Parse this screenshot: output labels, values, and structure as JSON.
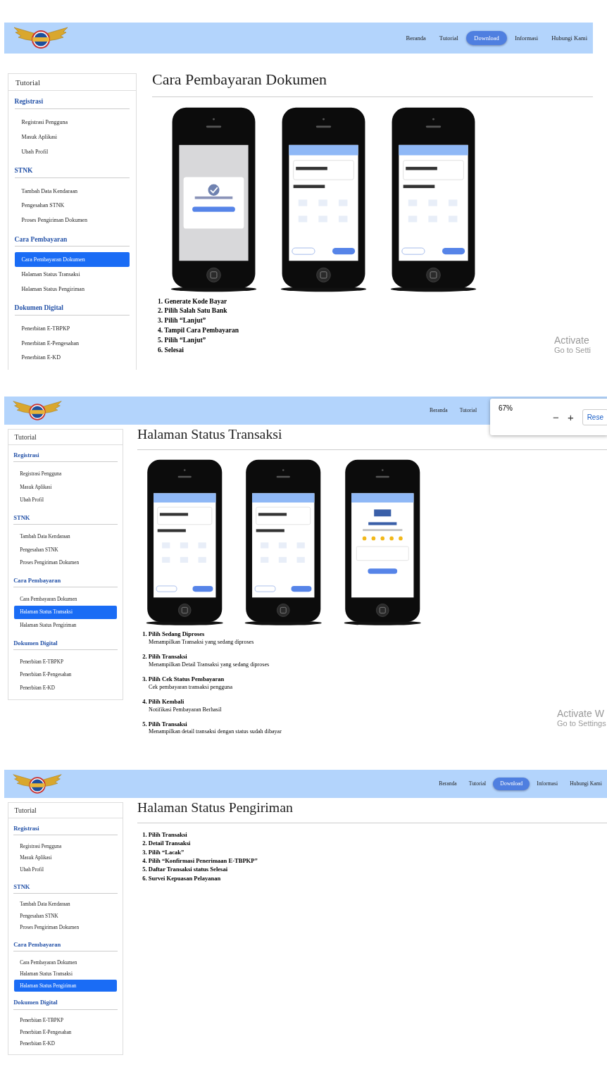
{
  "screens": [
    {
      "nav": [
        {
          "label": "Beranda",
          "selected": false
        },
        {
          "label": "Tutorial",
          "selected": false
        },
        {
          "label": "Download",
          "selected": true
        },
        {
          "label": "Informasi",
          "selected": false
        },
        {
          "label": "Hubungi Kami",
          "selected": false
        }
      ],
      "sidebar": {
        "title": "Tutorial",
        "sections": [
          {
            "heading": "Registrasi",
            "items": [
              {
                "label": "Registrasi Pengguna",
                "selected": false
              },
              {
                "label": "Masuk Aplikasi",
                "selected": false
              },
              {
                "label": "Ubah Profil",
                "selected": false
              }
            ]
          },
          {
            "heading": "STNK",
            "items": [
              {
                "label": "Tambah Data Kendaraan",
                "selected": false
              },
              {
                "label": "Pengesahan STNK",
                "selected": false
              },
              {
                "label": "Proses Pengiriman Dokumen",
                "selected": false
              }
            ]
          },
          {
            "heading": "Cara Pembayaran",
            "items": [
              {
                "label": "Cara Pembayaran Dokumen",
                "selected": true
              },
              {
                "label": "Halaman Status Transaksi",
                "selected": false
              },
              {
                "label": "Halaman Status Pengiriman",
                "selected": false
              }
            ]
          },
          {
            "heading": "Dokumen Digital",
            "items": [
              {
                "label": "Penerbitan E-TBPKP",
                "selected": false
              },
              {
                "label": "Penerbitan E-Pengesahan",
                "selected": false
              },
              {
                "label": "Penerbitan E-KD",
                "selected": false
              }
            ]
          }
        ]
      },
      "page_title": "Cara Pembayaran Dokumen",
      "phones": [
        {
          "kind": "dialog"
        },
        {
          "kind": "payment"
        },
        {
          "kind": "payment"
        }
      ],
      "steps": [
        {
          "title": "1. Generate Kode Bayar"
        },
        {
          "title": "2. Pilih Salah Satu Bank"
        },
        {
          "title": "3. Pilih “Lanjut”"
        },
        {
          "title": "4. Tampil Cara Pembayaran"
        },
        {
          "title": "5. Pilih “Lanjut”"
        },
        {
          "title": "6. Selesai"
        }
      ],
      "os_notice": {
        "title": "Activate",
        "subtitle": "Go to Setti"
      }
    },
    {
      "nav": [
        {
          "label": "Beranda",
          "selected": false
        },
        {
          "label": "Tutorial",
          "selected": false
        }
      ],
      "zoom_popup": {
        "value": "67%",
        "decrease": "−",
        "increase": "+",
        "reset": "Rese"
      },
      "sidebar": {
        "title": "Tutorial",
        "sections": [
          {
            "heading": "Registrasi",
            "items": [
              {
                "label": "Registrasi Pengguna",
                "selected": false
              },
              {
                "label": "Masuk Aplikasi",
                "selected": false
              },
              {
                "label": "Ubah Profil",
                "selected": false
              }
            ]
          },
          {
            "heading": "STNK",
            "items": [
              {
                "label": "Tambah Data Kendaraan",
                "selected": false
              },
              {
                "label": "Pengesahan STNK",
                "selected": false
              },
              {
                "label": "Proses Pengiriman Dokumen",
                "selected": false
              }
            ]
          },
          {
            "heading": "Cara Pembayaran",
            "items": [
              {
                "label": "Cara Pembayaran Dokumen",
                "selected": false
              },
              {
                "label": "Halaman Status Transaksi",
                "selected": true
              },
              {
                "label": "Halaman Status Pengiriman",
                "selected": false
              }
            ]
          },
          {
            "heading": "Dokumen Digital",
            "items": [
              {
                "label": "Penerbitan E-TBPKP",
                "selected": false
              },
              {
                "label": "Penerbitan E-Pengesahan",
                "selected": false
              },
              {
                "label": "Penerbitan E-KD",
                "selected": false
              }
            ]
          }
        ]
      },
      "page_title": "Halaman Status Transaksi",
      "phones": [
        {
          "kind": "payment"
        },
        {
          "kind": "payment"
        },
        {
          "kind": "survey"
        }
      ],
      "steps": [
        {
          "title": "1. Pilih Sedang Diproses",
          "description": "Menampilkan Transaksi yang sedang diproses"
        },
        {
          "title": "2. Pilih Transaksi",
          "description": "Menampilkan Detail Transaksi yang sedang diproses"
        },
        {
          "title": "3. Pilih Cek Status Pembayaran",
          "description": "Cek pembayaran transaksi pengguna"
        },
        {
          "title": "4. Pilih Kembali",
          "description": "Notifikasi Pembayaran Berhasil"
        },
        {
          "title": "5. Pilih Transaksi",
          "description": "Menampilkan detail transaksi dengan status sudah dibayar"
        }
      ],
      "os_notice": {
        "title": "Activate W",
        "subtitle": "Go to Settings"
      }
    },
    {
      "nav": [
        {
          "label": "Beranda",
          "selected": false
        },
        {
          "label": "Tutorial",
          "selected": false
        },
        {
          "label": "Download",
          "selected": true
        },
        {
          "label": "Informasi",
          "selected": false
        },
        {
          "label": "Hubungi Kami",
          "selected": false
        }
      ],
      "sidebar": {
        "title": "Tutorial",
        "sections": [
          {
            "heading": "Registrasi",
            "items": [
              {
                "label": "Registrasi Pengguna",
                "selected": false
              },
              {
                "label": "Masuk Aplikasi",
                "selected": false
              },
              {
                "label": "Ubah Profil",
                "selected": false
              }
            ]
          },
          {
            "heading": "STNK",
            "items": [
              {
                "label": "Tambah Data Kendaraan",
                "selected": false
              },
              {
                "label": "Pengesahan STNK",
                "selected": false
              },
              {
                "label": "Proses Pengiriman Dokumen",
                "selected": false
              }
            ]
          },
          {
            "heading": "Cara Pembayaran",
            "items": [
              {
                "label": "Cara Pembayaran Dokumen",
                "selected": false
              },
              {
                "label": "Halaman Status Transaksi",
                "selected": false
              },
              {
                "label": "Halaman Status Pengiriman",
                "selected": true
              }
            ]
          },
          {
            "heading": "Dokumen Digital",
            "items": [
              {
                "label": "Penerbitan E-TBPKP",
                "selected": false
              },
              {
                "label": "Penerbitan E-Pengesahan",
                "selected": false
              },
              {
                "label": "Penerbitan E-KD",
                "selected": false
              }
            ]
          }
        ]
      },
      "page_title": "Halaman Status Pengiriman",
      "steps": [
        {
          "title": "1. Pilih Transaksi"
        },
        {
          "title": "2. Detail Transaksi"
        },
        {
          "title": "3. Pilih “Lacak”"
        },
        {
          "title": "4. Pilih “Konfirmasi Penerimaan E-TBPKP”"
        },
        {
          "title": "5. Daftar Transaksi status Selesai"
        },
        {
          "title": "6. Survei Kepuasan Pelayanan"
        }
      ]
    }
  ]
}
